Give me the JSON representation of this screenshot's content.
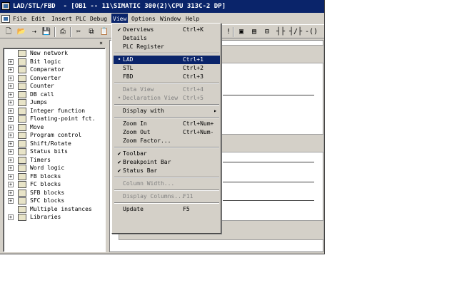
{
  "window": {
    "title": "LAD/STL/FBD  - [OB1 -- 11\\SIMATIC 300(2)\\CPU 313C-2 DP]"
  },
  "menubar": {
    "items": [
      "File",
      "Edit",
      "Insert",
      "PLC",
      "Debug",
      "View",
      "Options",
      "Window",
      "Help"
    ],
    "active": "View"
  },
  "toolbar": {
    "icons": [
      "new-icon",
      "open-icon",
      "save-icon",
      "print-icon",
      "cut-icon",
      "copy-icon",
      "paste-icon"
    ],
    "right_icons": [
      "overview-icon",
      "details-icon",
      "network-icon",
      "contact-no-icon",
      "contact-nc-icon",
      "coil-icon"
    ],
    "right_glyphs": [
      "!",
      "▣",
      "▤",
      "⊟",
      "┤├",
      "┤/├",
      "-()"
    ]
  },
  "program_elements": {
    "items": [
      {
        "label": "New network",
        "icon": "new-network-icon",
        "expandable": false
      },
      {
        "label": "Bit logic",
        "icon": "folder-icon",
        "expandable": true
      },
      {
        "label": "Comparator",
        "icon": "folder-icon",
        "expandable": true
      },
      {
        "label": "Converter",
        "icon": "folder-icon",
        "expandable": true
      },
      {
        "label": "Counter",
        "icon": "folder-icon",
        "expandable": true
      },
      {
        "label": "DB call",
        "icon": "folder-icon",
        "expandable": true
      },
      {
        "label": "Jumps",
        "icon": "folder-icon",
        "expandable": true
      },
      {
        "label": "Integer function",
        "icon": "folder-icon",
        "expandable": true
      },
      {
        "label": "Floating-point fct.",
        "icon": "folder-icon",
        "expandable": true
      },
      {
        "label": "Move",
        "icon": "folder-icon",
        "expandable": true
      },
      {
        "label": "Program control",
        "icon": "folder-icon",
        "expandable": true
      },
      {
        "label": "Shift/Rotate",
        "icon": "folder-icon",
        "expandable": true
      },
      {
        "label": "Status bits",
        "icon": "folder-icon",
        "expandable": true
      },
      {
        "label": "Timers",
        "icon": "folder-icon",
        "expandable": true
      },
      {
        "label": "Word logic",
        "icon": "folder-icon",
        "expandable": true
      },
      {
        "label": "FB blocks",
        "icon": "folder-icon",
        "expandable": true
      },
      {
        "label": "FC blocks",
        "icon": "folder-icon",
        "expandable": true
      },
      {
        "label": "SFB blocks",
        "icon": "folder-icon",
        "expandable": true
      },
      {
        "label": "SFC blocks",
        "icon": "folder-icon",
        "expandable": true
      },
      {
        "label": "Multiple instances",
        "icon": "multi-instance-icon",
        "expandable": false
      },
      {
        "label": "Libraries",
        "icon": "libraries-icon",
        "expandable": true
      }
    ]
  },
  "view_menu": {
    "items": [
      {
        "type": "item",
        "label": "Overviews",
        "shortcut": "Ctrl+K",
        "mark": "✔",
        "enabled": true,
        "highlighted": false
      },
      {
        "type": "item",
        "label": "Details",
        "shortcut": "",
        "mark": "",
        "enabled": true,
        "highlighted": false
      },
      {
        "type": "item",
        "label": "PLC Register",
        "shortcut": "",
        "mark": "",
        "enabled": true,
        "highlighted": false
      },
      {
        "type": "sep"
      },
      {
        "type": "item",
        "label": "LAD",
        "shortcut": "Ctrl+1",
        "mark": "•",
        "enabled": true,
        "highlighted": true
      },
      {
        "type": "item",
        "label": "STL",
        "shortcut": "Ctrl+2",
        "mark": "",
        "enabled": true,
        "highlighted": false
      },
      {
        "type": "item",
        "label": "FBD",
        "shortcut": "Ctrl+3",
        "mark": "",
        "enabled": true,
        "highlighted": false
      },
      {
        "type": "sep"
      },
      {
        "type": "item",
        "label": "Data View",
        "shortcut": "Ctrl+4",
        "mark": "",
        "enabled": false,
        "highlighted": false
      },
      {
        "type": "item",
        "label": "Declaration View",
        "shortcut": "Ctrl+5",
        "mark": "•",
        "enabled": false,
        "highlighted": false
      },
      {
        "type": "sep"
      },
      {
        "type": "item",
        "label": "Display with",
        "shortcut": "",
        "mark": "",
        "enabled": true,
        "highlighted": false,
        "submenu": true
      },
      {
        "type": "sep"
      },
      {
        "type": "item",
        "label": "Zoom In",
        "shortcut": "Ctrl+Num+",
        "mark": "",
        "enabled": true,
        "highlighted": false
      },
      {
        "type": "item",
        "label": "Zoom Out",
        "shortcut": "Ctrl+Num-",
        "mark": "",
        "enabled": true,
        "highlighted": false
      },
      {
        "type": "item",
        "label": "Zoom Factor...",
        "shortcut": "",
        "mark": "",
        "enabled": true,
        "highlighted": false
      },
      {
        "type": "sep"
      },
      {
        "type": "item",
        "label": "Toolbar",
        "shortcut": "",
        "mark": "✔",
        "enabled": true,
        "highlighted": false
      },
      {
        "type": "item",
        "label": "Breakpoint Bar",
        "shortcut": "",
        "mark": "✔",
        "enabled": true,
        "highlighted": false
      },
      {
        "type": "item",
        "label": "Status Bar",
        "shortcut": "",
        "mark": "✔",
        "enabled": true,
        "highlighted": false
      },
      {
        "type": "sep"
      },
      {
        "type": "item",
        "label": "Column Width...",
        "shortcut": "",
        "mark": "",
        "enabled": false,
        "highlighted": false
      },
      {
        "type": "sep"
      },
      {
        "type": "item",
        "label": "Display Columns...",
        "shortcut": "F11",
        "mark": "",
        "enabled": false,
        "highlighted": false
      },
      {
        "type": "sep"
      },
      {
        "type": "item",
        "label": "Update",
        "shortcut": "F5",
        "mark": "",
        "enabled": true,
        "highlighted": false
      }
    ]
  },
  "colors": {
    "titlebar": "#0a246a",
    "highlight": "#0a246a",
    "face": "#d4d0c8",
    "disabled_text": "#808080"
  }
}
